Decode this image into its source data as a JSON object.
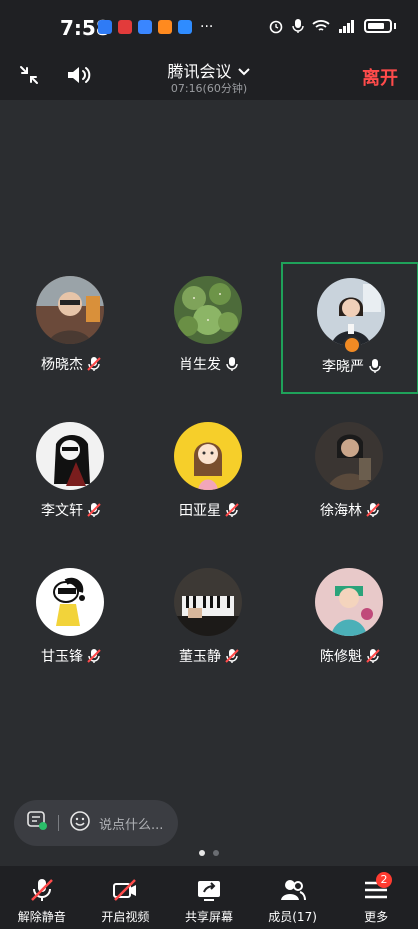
{
  "status_bar": {
    "time": "7:58",
    "app_icons": [
      {
        "name": "app-icon-blue",
        "color": "#2f7bf5"
      },
      {
        "name": "app-icon-red",
        "color": "#e23b3b"
      },
      {
        "name": "app-icon-blue2",
        "color": "#3a86ff"
      },
      {
        "name": "app-icon-orange",
        "color": "#ff8a1f"
      },
      {
        "name": "app-icon-cloud",
        "color": "#2f8cff"
      }
    ],
    "more": "···"
  },
  "top_bar": {
    "title": "腾讯会议",
    "subtitle": "07:16(60分钟)",
    "leave_label": "离开",
    "leave_color": "#ff4b4b"
  },
  "participants": [
    {
      "name": "杨晓杰",
      "mic": "muted"
    },
    {
      "name": "肖生发",
      "mic": "on"
    },
    {
      "name": "李晓严",
      "mic": "on",
      "host": true,
      "active": true
    },
    {
      "name": "李文轩",
      "mic": "muted"
    },
    {
      "name": "田亚星",
      "mic": "muted"
    },
    {
      "name": "徐海林",
      "mic": "muted"
    },
    {
      "name": "甘玉锋",
      "mic": "muted"
    },
    {
      "name": "董玉静",
      "mic": "muted"
    },
    {
      "name": "陈修魁",
      "mic": "muted"
    }
  ],
  "chat": {
    "placeholder": "说点什么..."
  },
  "bottom_bar": {
    "unmute_label": "解除静音",
    "video_label": "开启视频",
    "share_label": "共享屏幕",
    "members_label": "成员(17)",
    "more_label": "更多",
    "more_badge": "2"
  }
}
